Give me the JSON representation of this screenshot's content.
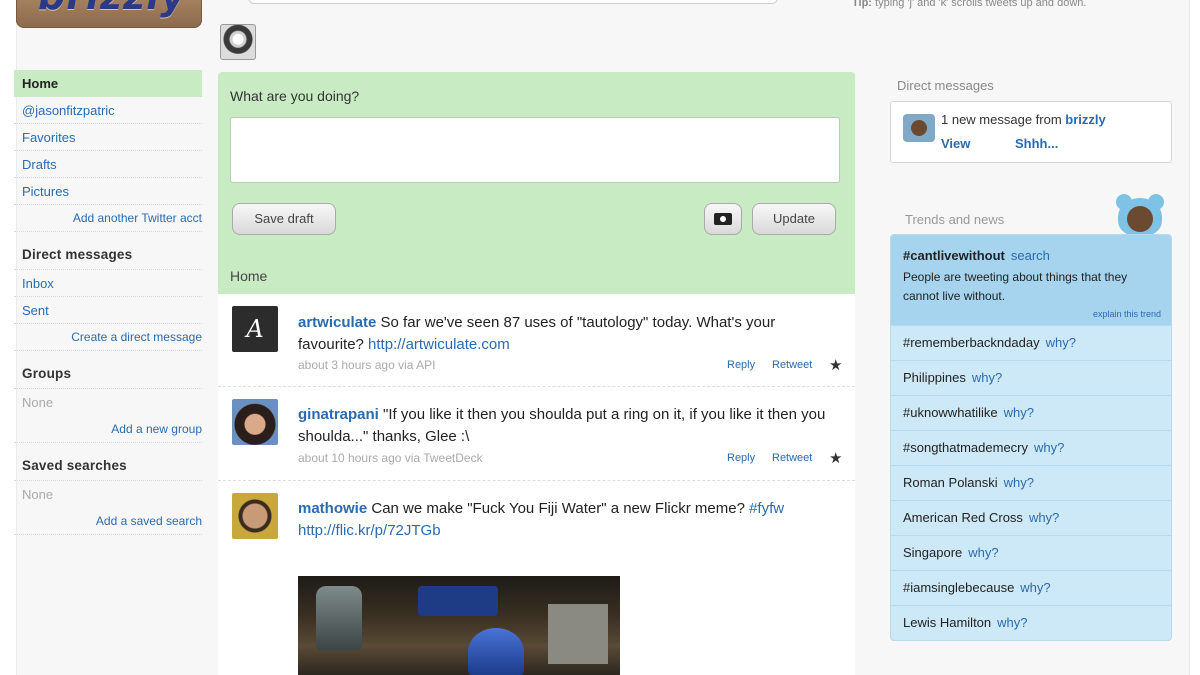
{
  "app": {
    "logo_text": "brizzly",
    "tip_prefix": "Tip:",
    "tip_text": "typing 'j' and 'k' scrolls tweets up and down."
  },
  "sidebar": {
    "items": [
      {
        "label": "Home",
        "active": true
      },
      {
        "label": "@jasonfitzpatric"
      },
      {
        "label": "Favorites"
      },
      {
        "label": "Drafts"
      },
      {
        "label": "Pictures"
      }
    ],
    "add_account": "Add another Twitter acct",
    "dm_heading": "Direct messages",
    "dm_items": [
      "Inbox",
      "Sent"
    ],
    "create_dm": "Create a direct message",
    "groups_heading": "Groups",
    "groups_none": "None",
    "add_group": "Add a new group",
    "saved_heading": "Saved searches",
    "saved_none": "None",
    "add_saved": "Add a saved search"
  },
  "composer": {
    "prompt": "What are you doing?",
    "text_value": "",
    "save_draft": "Save draft",
    "photo_icon": "camera-icon",
    "update": "Update",
    "section_label": "Home"
  },
  "tweets": [
    {
      "user": "artwiculate",
      "avatar_letter": "A",
      "text": "So far we've seen 87 uses of \"tautology\" today. What's your favourite?",
      "link": "http://artwiculate.com",
      "meta": "about 3 hours ago via API",
      "reply": "Reply",
      "retweet": "Retweet"
    },
    {
      "user": "ginatrapani",
      "text": "\"If you like it then you shoulda put a ring on it, if you like it then you shoulda...\" thanks, Glee :\\",
      "meta": "about 10 hours ago via TweetDeck",
      "reply": "Reply",
      "retweet": "Retweet"
    },
    {
      "user": "mathowie",
      "text": "Can we make \"Fuck You Fiji Water\" a new Flickr meme?",
      "hashtag": "#fyfw",
      "link": "http://flic.kr/p/72JTGb"
    }
  ],
  "direct_messages": {
    "title": "Direct messages",
    "text_prefix": "1 new message from",
    "from": "brizzly",
    "view": "View",
    "shhh": "Shhh..."
  },
  "trends": {
    "title": "Trends and news",
    "featured": {
      "name": "#cantlivewithout",
      "search": "search",
      "description": "People are tweeting about things that they cannot live without.",
      "explain": "explain this trend"
    },
    "items": [
      "#rememberbackndaday",
      "Philippines",
      "#uknowwhatilike",
      "#songthatmademecry",
      "Roman Polanski",
      "American Red Cross",
      "Singapore",
      "#iamsinglebecause",
      "Lewis Hamilton"
    ],
    "why_label": "why?"
  },
  "colors": {
    "accent_green": "#c9ebc3",
    "link_blue": "#2a6bb0",
    "trend_blue": "#cde8f7"
  }
}
